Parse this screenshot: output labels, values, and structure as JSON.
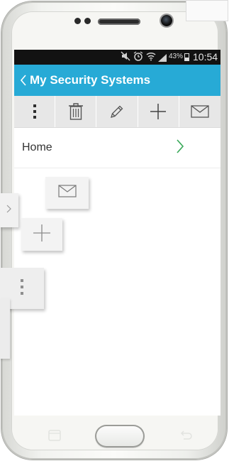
{
  "statusbar": {
    "battery_percent": "43%",
    "time": "10:54",
    "icons": [
      "mute-icon",
      "alarm-icon",
      "wifi-icon",
      "signal-icon",
      "battery-icon"
    ]
  },
  "appbar": {
    "title": "My Security Systems",
    "color": "#27aad6"
  },
  "toolbar": {
    "items": [
      {
        "icon": "more-vertical-icon"
      },
      {
        "icon": "trash-icon"
      },
      {
        "icon": "pencil-icon"
      },
      {
        "icon": "plus-icon"
      },
      {
        "icon": "mail-icon"
      }
    ]
  },
  "list": {
    "items": [
      {
        "label": "Home",
        "accessory": "chevron-right-icon",
        "accent": "#3aa95a"
      }
    ]
  },
  "overlay_tiles": [
    "mail-icon",
    "plus-icon",
    "more-vertical-icon",
    "chevron-right-icon"
  ],
  "device": {
    "softkeys": [
      "recent-apps-icon",
      "back-icon"
    ]
  }
}
